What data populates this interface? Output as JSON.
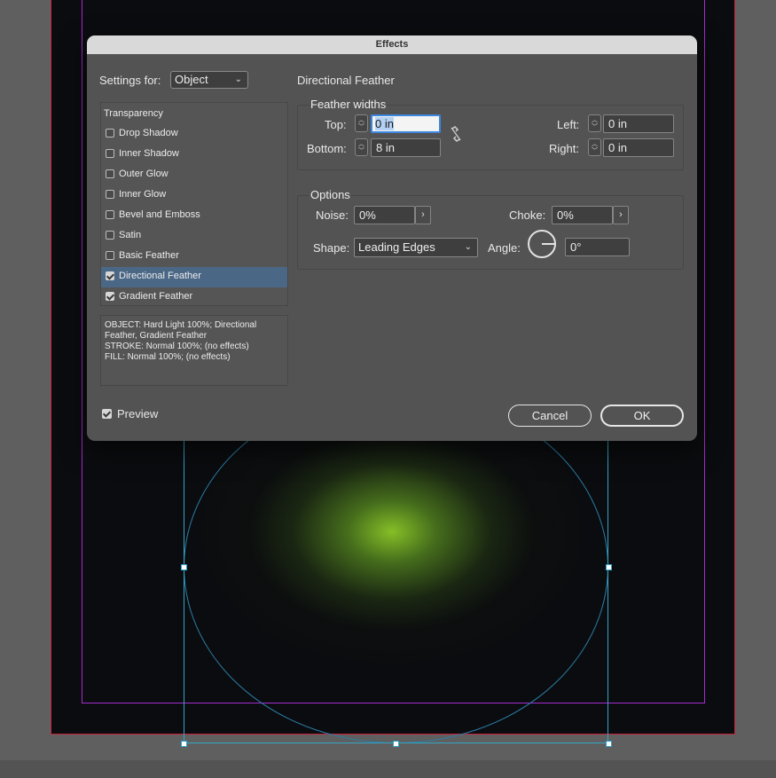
{
  "dialog": {
    "title": "Effects",
    "settings_for_label": "Settings for:",
    "settings_for_value": "Object",
    "list_heading": "Transparency",
    "effects": [
      {
        "label": "Drop Shadow",
        "checked": false,
        "selected": false
      },
      {
        "label": "Inner Shadow",
        "checked": false,
        "selected": false
      },
      {
        "label": "Outer Glow",
        "checked": false,
        "selected": false
      },
      {
        "label": "Inner Glow",
        "checked": false,
        "selected": false
      },
      {
        "label": "Bevel and Emboss",
        "checked": false,
        "selected": false
      },
      {
        "label": "Satin",
        "checked": false,
        "selected": false
      },
      {
        "label": "Basic Feather",
        "checked": false,
        "selected": false
      },
      {
        "label": "Directional Feather",
        "checked": true,
        "selected": true
      },
      {
        "label": "Gradient Feather",
        "checked": true,
        "selected": false
      }
    ],
    "summary": [
      "OBJECT: Hard Light 100%; Directional Feather, Gradient Feather",
      "STROKE: Normal 100%; (no effects)",
      "FILL: Normal 100%; (no effects)"
    ],
    "preview_label": "Preview",
    "preview_checked": true,
    "panel_title": "Directional Feather",
    "feather_widths": {
      "title": "Feather widths",
      "top_label": "Top:",
      "top_value": "0 in",
      "bottom_label": "Bottom:",
      "bottom_value": "8 in",
      "left_label": "Left:",
      "left_value": "0 in",
      "right_label": "Right:",
      "right_value": "0 in"
    },
    "options": {
      "title": "Options",
      "noise_label": "Noise:",
      "noise_value": "0%",
      "choke_label": "Choke:",
      "choke_value": "0%",
      "shape_label": "Shape:",
      "shape_value": "Leading Edges",
      "angle_label": "Angle:",
      "angle_value": "0°"
    },
    "cancel_label": "Cancel",
    "ok_label": "OK"
  },
  "icons": {
    "link": "unlinked-chain-icon",
    "spinner": "stepper-icon",
    "dropdown": "chevron-down-icon",
    "popup": "chevron-right-icon",
    "angle": "angle-dial-icon"
  },
  "colors": {
    "dialog_bg": "#535353",
    "selected_row": "#4b6786",
    "focus_ring": "#3d87e0",
    "glow": "#8cc828",
    "path": "#34a6c8",
    "bleed_guide": "#c8213a",
    "margin_guide": "#a42bd1"
  }
}
